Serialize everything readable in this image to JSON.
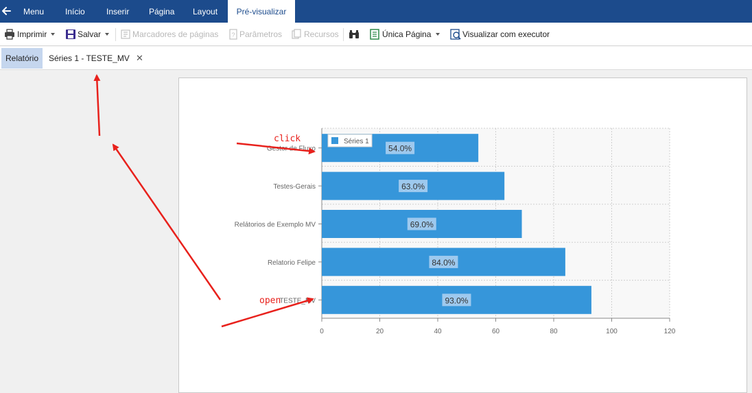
{
  "topbar": {
    "menu": "Menu",
    "inicio": "Início",
    "inserir": "Inserir",
    "pagina": "Página",
    "layout": "Layout",
    "previsualizar": "Pré-visualizar"
  },
  "toolbar": {
    "imprimir": "Imprimir",
    "salvar": "Salvar",
    "marcadores": "Marcadores de páginas",
    "parametros": "Parâmetros",
    "recursos": "Recursos",
    "unica_pagina": "Única Página",
    "visualizar": "Visualizar com executor"
  },
  "tabs": {
    "relatorio": "Relatório",
    "series_tab": "Séries 1 - TESTE_MV",
    "close_symbol": "✕"
  },
  "annotations": {
    "click": "click",
    "open": "open"
  },
  "colors": {
    "bar": "#3696da",
    "topbar": "#1c4b8c",
    "arrow": "#e8211c"
  },
  "chart_data": {
    "type": "bar",
    "orientation": "horizontal",
    "categories": [
      "Gestor de Fluxo",
      "Testes-Gerais",
      "Relátorios de Exemplo MV",
      "Relatorio Felipe",
      "TESTE_MV"
    ],
    "series": [
      {
        "name": "Séries 1",
        "values": [
          54,
          63,
          69,
          84,
          93
        ],
        "labels": [
          "54.0%",
          "63.0%",
          "69.0%",
          "84.0%",
          "93.0%"
        ]
      }
    ],
    "xticks": [
      "0",
      "20",
      "40",
      "60",
      "80",
      "100",
      "120"
    ],
    "xlim": [
      0,
      120
    ],
    "grid": true,
    "legend": "top-left"
  }
}
